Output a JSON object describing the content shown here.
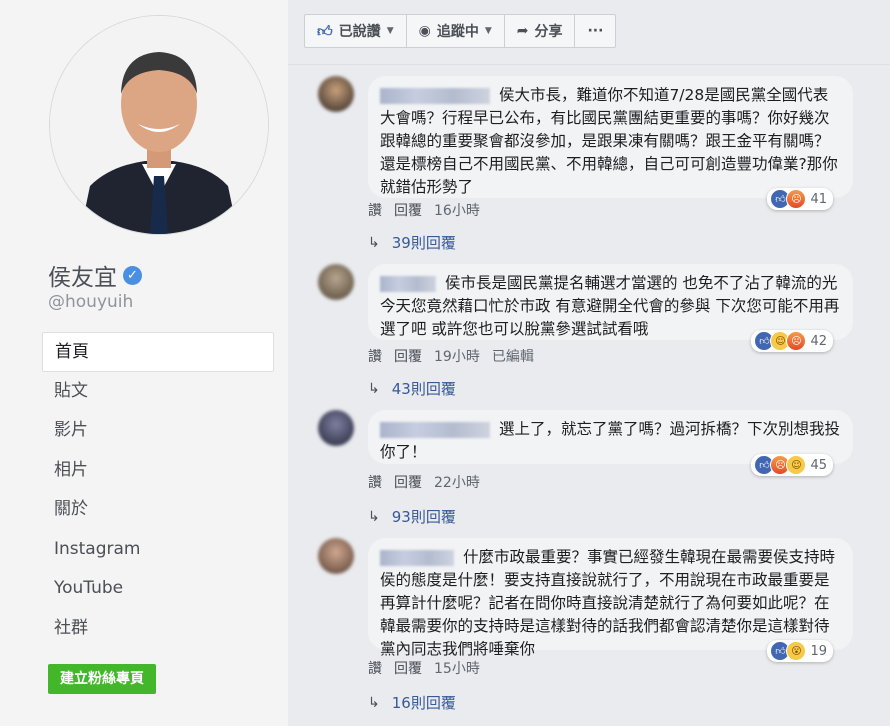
{
  "profile": {
    "name": "侯友宜",
    "handle": "@houyuih",
    "verified_icon": "verified-badge-icon"
  },
  "nav": [
    {
      "label": "首頁",
      "active": true
    },
    {
      "label": "貼文"
    },
    {
      "label": "影片"
    },
    {
      "label": "相片"
    },
    {
      "label": "關於"
    },
    {
      "label": "Instagram"
    },
    {
      "label": "YouTube"
    },
    {
      "label": "社群"
    }
  ],
  "create_page_label": "建立粉絲專頁",
  "actions": {
    "liked": "已說讚",
    "following": "追蹤中",
    "share": "分享",
    "more": "···"
  },
  "comments": [
    {
      "text": "侯大市長，難道你不知道7/28是國民黨全國代表大會嗎？行程早已公布，有比國民黨團結更重要的事嗎？你好幾次跟韓總的重要聚會都沒參加，是跟果凍有關嗎？跟王金平有關嗎？還是標榜自己不用國民黨、不用韓總，自己可可創造豐功偉業?那你就錯估形勢了",
      "reaction_count": "41",
      "like_label": "讚",
      "reply_label": "回覆",
      "time": "16小時",
      "edited": "",
      "replies": "39則回覆"
    },
    {
      "text": "侯市長是國民黨提名輔選才當選的 也免不了沾了韓流的光 今天您竟然藉口忙於市政 有意避開全代會的參與 下次您可能不用再選了吧 或許您也可以脫黨參選試試看哦",
      "reaction_count": "42",
      "like_label": "讚",
      "reply_label": "回覆",
      "time": "19小時",
      "edited": "已編輯",
      "replies": "43則回覆"
    },
    {
      "text": "選上了，就忘了黨了嗎？過河拆橋？下次別想我投你了！",
      "reaction_count": "45",
      "like_label": "讚",
      "reply_label": "回覆",
      "time": "22小時",
      "edited": "",
      "replies": "93則回覆"
    },
    {
      "text": "什麼市政最重要？事實已經發生韓現在最需要侯支持時侯的態度是什麼！要支持直接說就行了，不用說現在市政最重要是再算計什麼呢？記者在問你時直接說清楚就行了為何要如此呢？在韓最需要你的支持時是這樣對待的話我們都會認清楚你是這樣對待黨內同志我們將唾棄你",
      "reaction_count": "19",
      "like_label": "讚",
      "reply_label": "回覆",
      "time": "15小時",
      "edited": "",
      "replies": "16則回覆"
    }
  ]
}
